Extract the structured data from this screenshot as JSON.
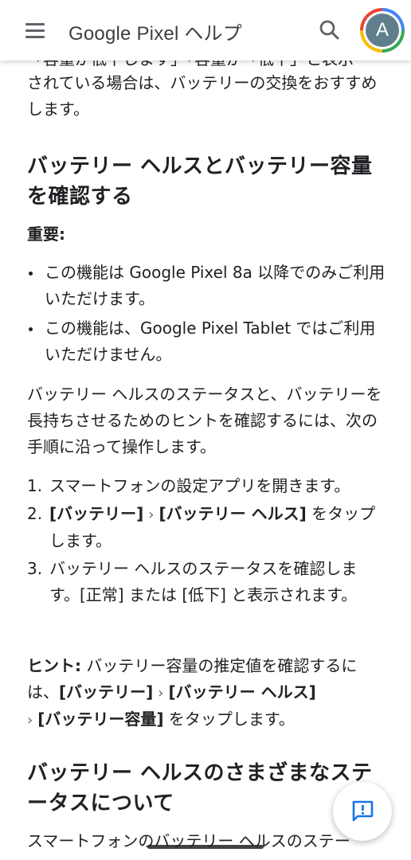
{
  "appbar": {
    "title": "Google Pixel ヘルプ",
    "avatar_letter": "A",
    "icons": {
      "menu": "menu-icon",
      "search": "search-icon"
    }
  },
  "content": {
    "cut_line": "「容量が低下します」「容量が「低下」と表示",
    "intro_paragraph": "されている場合は、バッテリーの交換をおすすめします。",
    "section1": {
      "heading": "バッテリー ヘルスとバッテリー容量を確認する",
      "important_label": "重要:",
      "bullets": [
        "この機能は Google Pixel 8a 以降でのみご利用いただけます。",
        "この機能は、Google Pixel Tablet ではご利用いただけません。"
      ],
      "description": "バッテリー ヘルスのステータスと、バッテリーを長持ちさせるためのヒントを確認するには、次の手順に沿って操作します。",
      "steps": [
        {
          "num": "1.",
          "text": "スマートフォンの設定アプリを開きます。"
        },
        {
          "num": "2.",
          "part1": "[バッテリー]",
          "part2": "[バッテリー ヘルス]",
          "part3": " をタップします。"
        },
        {
          "num": "3.",
          "text": "バッテリー ヘルスのステータスを確認します。[正常] または [低下] と表示されます。"
        }
      ],
      "hint": {
        "label": "ヒント:",
        "text1": " バッテリー容量の推定値を確認するには、",
        "part1": "[バッテリー]",
        "part2": "[バッテリー ヘルス]",
        "part3": "[バッテリー容量]",
        "text2": " をタップします。"
      }
    },
    "section2": {
      "heading": "バッテリー ヘルスのさまざまなステータスについて",
      "paragraph_start": "スマートフォンのバッテリー ヘルスのステー"
    }
  },
  "chevron_char": "›",
  "colors": {
    "text": "#202124",
    "icon": "#5f6368",
    "accent": "#1a73e8"
  }
}
